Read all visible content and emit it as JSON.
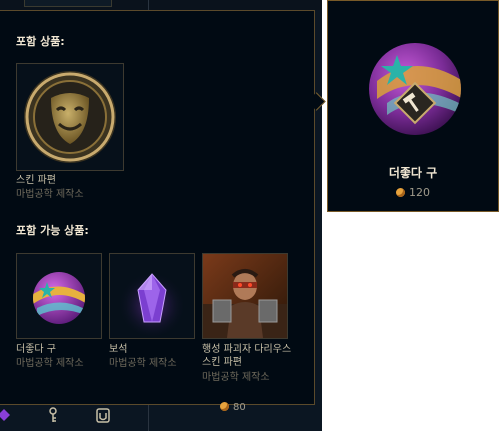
{
  "card": {
    "name": "더좋다 구",
    "price": "120",
    "icon": "orb-icon",
    "currency_icon": "orange-essence-icon"
  },
  "popup": {
    "included_title": "포함 상품:",
    "possible_title": "포함 가능 상품:",
    "included_items": [
      {
        "name": "스킨 파편",
        "source": "마법공학 제작소",
        "icon": "skin-shard-mask-icon"
      }
    ],
    "possible_items": [
      {
        "name": "더좋다 구",
        "source": "마법공학 제작소",
        "icon": "orb-icon"
      },
      {
        "name": "보석",
        "source": "마법공학 제작소",
        "icon": "gemstone-icon"
      },
      {
        "name": "행성 파괴자 다리우스 스킨 파편",
        "source": "마법공학 제작소",
        "icon": "skin-portrait-icon"
      }
    ]
  },
  "bottom": {
    "price": "80",
    "icons": [
      "gem-icon",
      "key-icon",
      "chest-icon"
    ]
  },
  "colors": {
    "gold_border": "#785a28",
    "title_text": "#f0e6d2",
    "subtext": "#6f6a5c",
    "background": "#010a13"
  }
}
